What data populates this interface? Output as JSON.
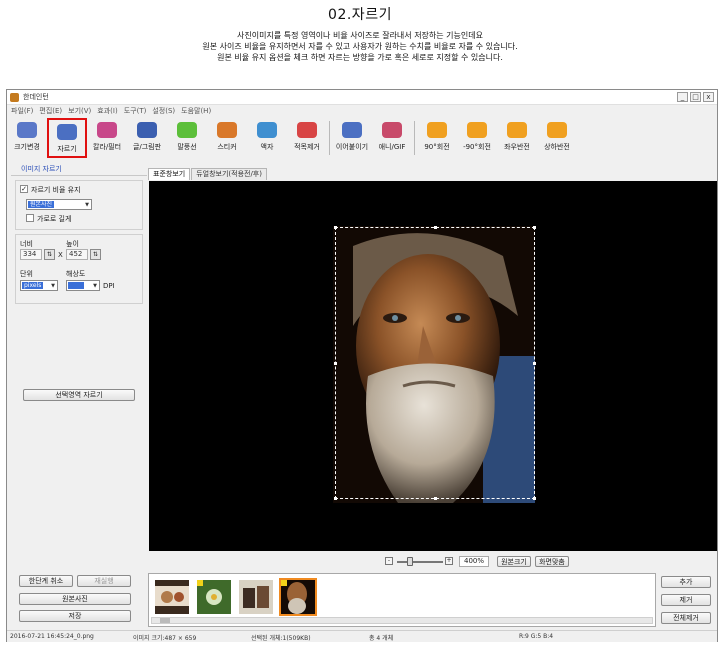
{
  "page": {
    "heading": "02.자르기",
    "intro_lines": [
      "사진이미지를 특정 영역이나 비율 사이즈로 잘라내서 저장하는 기능인데요",
      "원본 사이즈 비율을 유지하면서 자를 수 있고 사용자가 원하는 수치를  비율로 자를 수 있습니다.",
      "원본 비율 유지 옵션을 체크 하면  자르는 방향을 가로 혹은 세로로 지정할 수 있습니다."
    ]
  },
  "window": {
    "title": "한데인턴",
    "controls": [
      "_",
      "□",
      "x"
    ],
    "menu": [
      "파일(F)",
      "편집(E)",
      "보기(V)",
      "효과(I)",
      "도구(T)",
      "설정(S)",
      "도움말(H)"
    ]
  },
  "toolbar": {
    "items": [
      {
        "label": "크기변경",
        "icon": "resize-icon",
        "color": "#5a78c8"
      },
      {
        "label": "자르기",
        "icon": "crop-icon",
        "color": "#4b6fc2",
        "active": true
      },
      {
        "label": "칼라/필터",
        "icon": "color-filter-icon",
        "color": "#c8488a"
      },
      {
        "label": "글/그림판",
        "icon": "text-draw-icon",
        "color": "#3b5fb0"
      },
      {
        "label": "말풍선",
        "icon": "speech-bubble-icon",
        "color": "#5cbf3a"
      },
      {
        "label": "스티커",
        "icon": "sticker-icon",
        "color": "#d9782a"
      },
      {
        "label": "액자",
        "icon": "frame-icon",
        "color": "#3f8fd0"
      },
      {
        "label": "적목제거",
        "icon": "red-eye-icon",
        "color": "#d84545"
      },
      {
        "label": "이어붙이기",
        "icon": "merge-icon",
        "color": "#4b6fc2"
      },
      {
        "label": "애니/GIF",
        "icon": "gif-icon",
        "color": "#c84a6a"
      },
      {
        "label": "90°회전",
        "icon": "rotate-cw-icon",
        "color": "#f0a020"
      },
      {
        "label": "-90°회전",
        "icon": "rotate-ccw-icon",
        "color": "#f0a020"
      },
      {
        "label": "좌우반전",
        "icon": "flip-horizontal-icon",
        "color": "#f0a020"
      },
      {
        "label": "상하반전",
        "icon": "flip-vertical-icon",
        "color": "#f0a020"
      }
    ],
    "highlight_color": "#e01010"
  },
  "panel": {
    "title": "이미지 자르기",
    "keep_ratio_label": "자르기 비율 유지",
    "keep_ratio_checked": true,
    "ratio_value": "원본사진",
    "horizontal_label": "가로로 길게",
    "horizontal_checked": false,
    "width_label": "너비",
    "height_label": "높이",
    "width_value": "334",
    "height_value": "452",
    "times": "X",
    "unit_label": "단위",
    "unit_value": "pixels",
    "resolution_label": "해상도",
    "dpi_label": "DPI",
    "crop_button": "선택영역 자르기"
  },
  "tabs": [
    "표준창보기",
    "듀얼창보기(적용전/후)"
  ],
  "zoom": {
    "minus": "-",
    "plus": "+",
    "value": "400%",
    "original_button": "원본크기",
    "fit_button": "화면맞춤"
  },
  "bottom_left": {
    "undo": "한단계 취소",
    "redo": "재실행",
    "original": "원본사진",
    "save": "저장"
  },
  "bottom_right": {
    "add": "추가",
    "remove": "제거",
    "remove_all": "전체제거"
  },
  "status": {
    "file": "2016-07-21 16:45:24_0.png",
    "image_size": "이미지 크기:487 × 659",
    "selected": "선택된 개체:1(509KB)",
    "total": "총 4 개체",
    "color": "R:9 G:5 B:4"
  }
}
